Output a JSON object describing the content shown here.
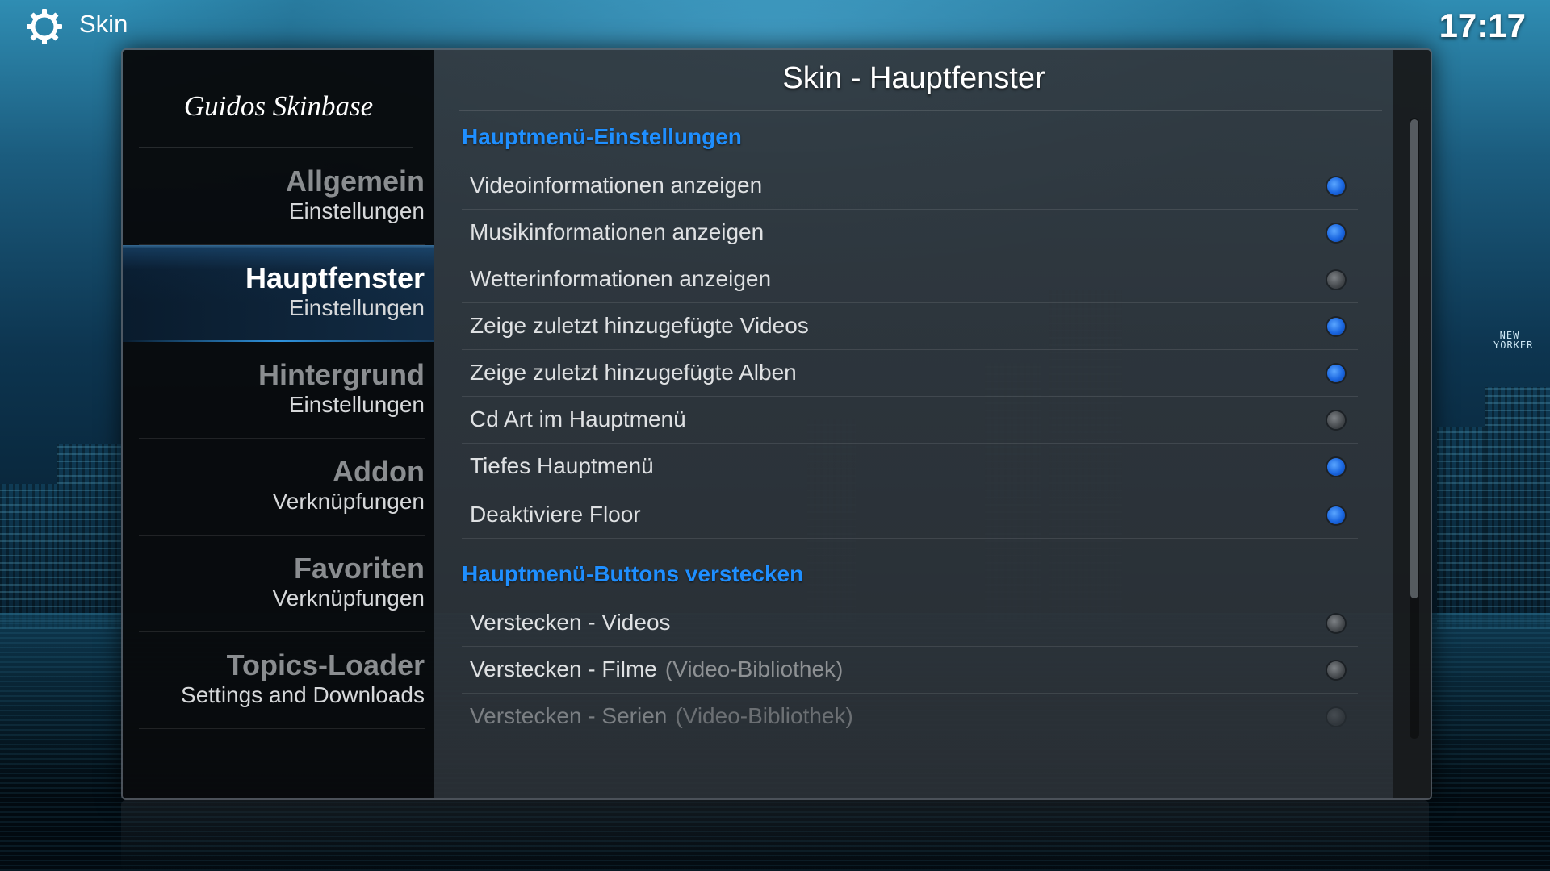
{
  "header": {
    "section_title": "Skin",
    "clock": "17:17",
    "icon": "gear-icon"
  },
  "sidebar": {
    "logo_text": "Guidos Skinbase",
    "items": [
      {
        "title": "Allgemein",
        "subtitle": "Einstellungen",
        "active": false
      },
      {
        "title": "Hauptfenster",
        "subtitle": "Einstellungen",
        "active": true
      },
      {
        "title": "Hintergrund",
        "subtitle": "Einstellungen",
        "active": false
      },
      {
        "title": "Addon",
        "subtitle": "Verknüpfungen",
        "active": false
      },
      {
        "title": "Favoriten",
        "subtitle": "Verknüpfungen",
        "active": false
      },
      {
        "title": "Topics-Loader",
        "subtitle": "Settings and Downloads",
        "active": false
      }
    ]
  },
  "main": {
    "title": "Skin - Hauptfenster",
    "sections": [
      {
        "header": "Hauptmenü-Einstellungen",
        "rows": [
          {
            "label": "Videoinformationen anzeigen",
            "hint": "",
            "enabled": true
          },
          {
            "label": "Musikinformationen anzeigen",
            "hint": "",
            "enabled": true
          },
          {
            "label": "Wetterinformationen anzeigen",
            "hint": "",
            "enabled": false
          },
          {
            "label": "Zeige zuletzt hinzugefügte Videos",
            "hint": "",
            "enabled": true
          },
          {
            "label": "Zeige zuletzt hinzugefügte Alben",
            "hint": "",
            "enabled": true
          },
          {
            "label": "Cd Art im Hauptmenü",
            "hint": "",
            "enabled": false
          },
          {
            "label": "Tiefes Hauptmenü",
            "hint": "",
            "enabled": true
          },
          {
            "label": "Deaktiviere Floor",
            "hint": "",
            "enabled": true
          }
        ]
      },
      {
        "header": "Hauptmenü-Buttons verstecken",
        "rows": [
          {
            "label": "Verstecken - Videos",
            "hint": "",
            "enabled": false
          },
          {
            "label": "Verstecken - Filme",
            "hint": "(Video-Bibliothek)",
            "enabled": false
          },
          {
            "label": "Verstecken - Serien",
            "hint": "(Video-Bibliothek)",
            "enabled": false,
            "dimmed": true
          }
        ]
      }
    ]
  },
  "background": {
    "neon_sign": "NEW YORKER"
  },
  "colors": {
    "accent": "#1f8fff",
    "radio_on": "#1a66e0",
    "radio_off": "#55595d"
  }
}
